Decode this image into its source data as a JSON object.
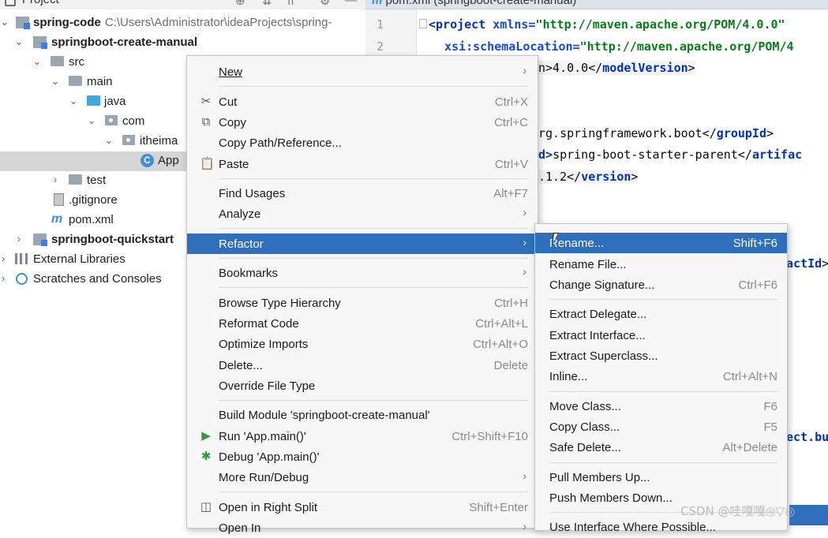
{
  "topbar": {
    "project_label": "Project"
  },
  "editor_tab": {
    "icon_glyph": "m",
    "title": "pom.xml (springboot-create-manual)"
  },
  "tree": {
    "root": {
      "name": "spring-code",
      "path": "C:\\Users\\Administrator\\ideaProjects\\spring-"
    },
    "module": "springboot-create-manual",
    "src": "src",
    "main": "main",
    "java": "java",
    "com": "com",
    "itheima": "itheima",
    "app": "App",
    "app_icon": "C",
    "test": "test",
    "gitignore": ".gitignore",
    "pom_icon": "m",
    "pom": "pom.xml",
    "quickstart": "springboot-quickstart",
    "external": "External Libraries",
    "scratches": "Scratches and Consoles"
  },
  "code": {
    "line_numbers": [
      "1",
      "2"
    ],
    "l1_tag": "<project",
    "l1_attr": " xmlns=",
    "l1_val": "\"http://maven.apache.org/POM/4.0.0\"",
    "l2_attr": "xsi:schemaLocation=",
    "l2_val": "\"http://maven.apache.org/POM/4",
    "l3_tail": "n>4.0.0</",
    "l3_tag": "modelVersion",
    "l3_end": ">",
    "l4_text": "rg.springframework.boot</",
    "l4_tag": "groupId",
    "l4_end": ">",
    "l5_d": "d>",
    "l5_text": "spring-boot-starter-parent</",
    "l5_tag": "artifac",
    "l6_text": ".1.2</",
    "l6_tag": "version",
    "l6_end": ">",
    "l7_tag": "actId",
    "l7_end": ">",
    "l8_tag": "ect.bu"
  },
  "menu": {
    "new": "New",
    "cut": "Cut",
    "cut_sc": "Ctrl+X",
    "copy": "Copy",
    "copy_sc": "Ctrl+C",
    "copy_path": "Copy Path/Reference...",
    "paste": "Paste",
    "paste_sc": "Ctrl+V",
    "find_usages": "Find Usages",
    "find_usages_sc": "Alt+F7",
    "analyze": "Analyze",
    "refactor": "Refactor",
    "bookmarks": "Bookmarks",
    "browse_type": "Browse Type Hierarchy",
    "browse_type_sc": "Ctrl+H",
    "reformat": "Reformat Code",
    "reformat_sc": "Ctrl+Alt+L",
    "optimize": "Optimize Imports",
    "optimize_sc": "Ctrl+Alt+O",
    "delete": "Delete...",
    "delete_sc": "Delete",
    "override": "Override File Type",
    "build": "Build Module 'springboot-create-manual'",
    "run": "Run 'App.main()'",
    "run_sc": "Ctrl+Shift+F10",
    "debug": "Debug 'App.main()'",
    "more_run": "More Run/Debug",
    "open_split": "Open in Right Split",
    "open_split_sc": "Shift+Enter",
    "open_in": "Open In"
  },
  "submenu": {
    "rename": "Rename...",
    "rename_sc": "Shift+F6",
    "rename_file": "Rename File...",
    "change_sig": "Change Signature...",
    "change_sig_sc": "Ctrl+F6",
    "extract_delegate": "Extract Delegate...",
    "extract_interface": "Extract Interface...",
    "extract_superclass": "Extract Superclass...",
    "inline": "Inline...",
    "inline_sc": "Ctrl+Alt+N",
    "move_class": "Move Class...",
    "move_class_sc": "F6",
    "copy_class": "Copy Class...",
    "copy_class_sc": "F5",
    "safe_delete": "Safe Delete...",
    "safe_delete_sc": "Alt+Delete",
    "pull_up": "Pull Members Up...",
    "push_down": "Push Members Down...",
    "use_interface": "Use Interface Where Possible..."
  },
  "watermark": "CSDN @哇嘎嘎◎▽◎",
  "colors": {
    "selection": "#2f6ebb",
    "tree_selected": "#d5d5d5"
  }
}
